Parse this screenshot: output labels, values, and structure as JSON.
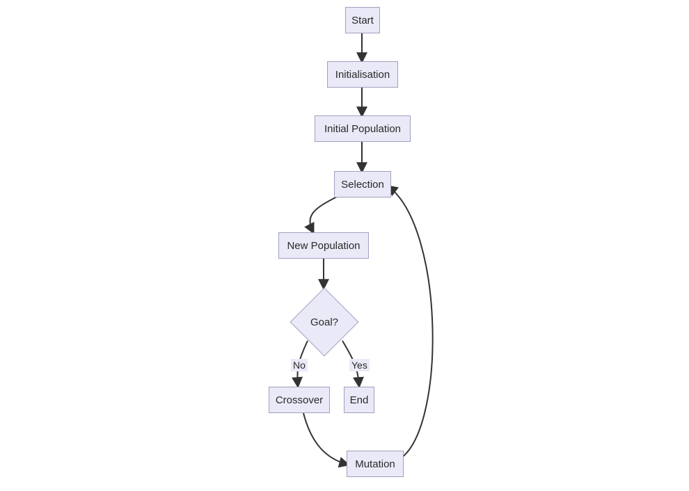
{
  "nodes": {
    "start": "Start",
    "init": "Initialisation",
    "ipop": "Initial Population",
    "sel": "Selection",
    "npop": "New Population",
    "goal": "Goal?",
    "cross": "Crossover",
    "end": "End",
    "mut": "Mutation"
  },
  "edge_labels": {
    "no": "No",
    "yes": "Yes"
  },
  "chart_data": {
    "type": "flowchart",
    "nodes": [
      {
        "id": "start",
        "label": "Start",
        "shape": "rect"
      },
      {
        "id": "init",
        "label": "Initialisation",
        "shape": "rect"
      },
      {
        "id": "ipop",
        "label": "Initial Population",
        "shape": "rect"
      },
      {
        "id": "sel",
        "label": "Selection",
        "shape": "rect"
      },
      {
        "id": "npop",
        "label": "New Population",
        "shape": "rect"
      },
      {
        "id": "goal",
        "label": "Goal?",
        "shape": "diamond"
      },
      {
        "id": "cross",
        "label": "Crossover",
        "shape": "rect"
      },
      {
        "id": "end",
        "label": "End",
        "shape": "rect"
      },
      {
        "id": "mut",
        "label": "Mutation",
        "shape": "rect"
      }
    ],
    "edges": [
      {
        "from": "start",
        "to": "init"
      },
      {
        "from": "init",
        "to": "ipop"
      },
      {
        "from": "ipop",
        "to": "sel"
      },
      {
        "from": "sel",
        "to": "npop"
      },
      {
        "from": "npop",
        "to": "goal"
      },
      {
        "from": "goal",
        "to": "cross",
        "label": "No"
      },
      {
        "from": "goal",
        "to": "end",
        "label": "Yes"
      },
      {
        "from": "cross",
        "to": "mut"
      },
      {
        "from": "mut",
        "to": "sel"
      }
    ]
  }
}
